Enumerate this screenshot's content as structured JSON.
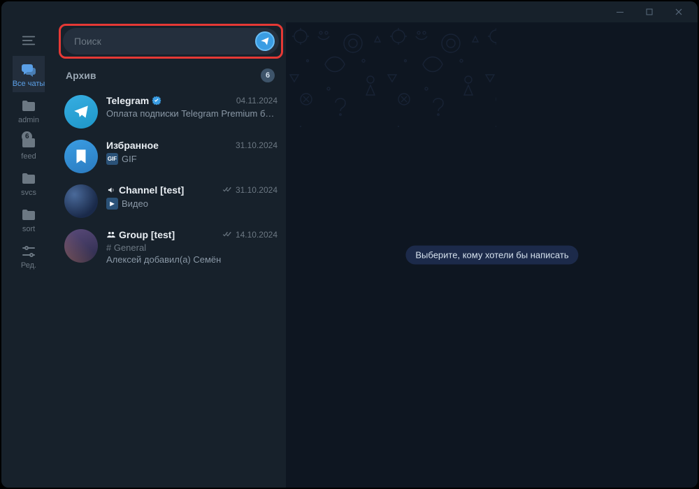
{
  "search": {
    "placeholder": "Поиск"
  },
  "folders": [
    {
      "key": "all",
      "label": "Все чаты",
      "icon": "chat",
      "active": true,
      "badge": null
    },
    {
      "key": "admin",
      "label": "admin",
      "icon": "folder",
      "active": false,
      "badge": null
    },
    {
      "key": "feed",
      "label": "feed",
      "icon": "folder",
      "active": false,
      "badge": "6"
    },
    {
      "key": "svcs",
      "label": "svcs",
      "icon": "folder",
      "active": false,
      "badge": null
    },
    {
      "key": "sort",
      "label": "sort",
      "icon": "folder",
      "active": false,
      "badge": null
    },
    {
      "key": "edit",
      "label": "Ред.",
      "icon": "settings",
      "active": false,
      "badge": null
    }
  ],
  "archive": {
    "label": "Архив",
    "count": "6"
  },
  "chats": [
    {
      "name": "Telegram",
      "verified": true,
      "type": "none",
      "date": "04.11.2024",
      "checks": false,
      "line2_icon": null,
      "line2": "Оплата подписки Telegram Premium б…",
      "line3": null,
      "avatar": "telegram"
    },
    {
      "name": "Избранное",
      "verified": false,
      "type": "none",
      "date": "31.10.2024",
      "checks": false,
      "line2_icon": "gif",
      "line2": "GIF",
      "line3": null,
      "avatar": "saved"
    },
    {
      "name": "Channel [test]",
      "verified": false,
      "type": "channel",
      "date": "31.10.2024",
      "checks": true,
      "line2_icon": "video",
      "line2": "Видео",
      "line3": null,
      "avatar": "channel"
    },
    {
      "name": "Group [test]",
      "verified": false,
      "type": "group",
      "date": "14.10.2024",
      "checks": true,
      "line2_icon": null,
      "line2_hash": "# General",
      "line3": "Алексей добавил(а) Семён",
      "avatar": "group"
    }
  ],
  "main": {
    "placeholder": "Выберите, кому хотели бы написать"
  }
}
